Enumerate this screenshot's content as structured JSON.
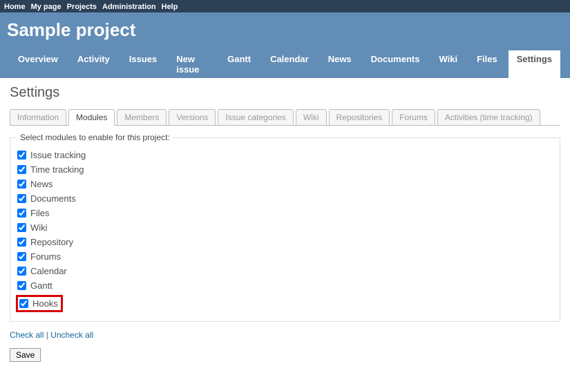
{
  "topMenu": [
    "Home",
    "My page",
    "Projects",
    "Administration",
    "Help"
  ],
  "projectTitle": "Sample project",
  "mainTabs": [
    {
      "label": "Overview",
      "active": false
    },
    {
      "label": "Activity",
      "active": false
    },
    {
      "label": "Issues",
      "active": false
    },
    {
      "label": "New issue",
      "active": false
    },
    {
      "label": "Gantt",
      "active": false
    },
    {
      "label": "Calendar",
      "active": false
    },
    {
      "label": "News",
      "active": false
    },
    {
      "label": "Documents",
      "active": false
    },
    {
      "label": "Wiki",
      "active": false
    },
    {
      "label": "Files",
      "active": false
    },
    {
      "label": "Settings",
      "active": true
    }
  ],
  "pageTitle": "Settings",
  "subTabs": [
    {
      "label": "Information",
      "active": false
    },
    {
      "label": "Modules",
      "active": true
    },
    {
      "label": "Members",
      "active": false
    },
    {
      "label": "Versions",
      "active": false
    },
    {
      "label": "Issue categories",
      "active": false
    },
    {
      "label": "Wiki",
      "active": false
    },
    {
      "label": "Repositories",
      "active": false
    },
    {
      "label": "Forums",
      "active": false
    },
    {
      "label": "Activities (time tracking)",
      "active": false
    }
  ],
  "fieldsetLegend": "Select modules to enable for this project:",
  "modules": [
    {
      "label": "Issue tracking",
      "checked": true,
      "highlighted": false
    },
    {
      "label": "Time tracking",
      "checked": true,
      "highlighted": false
    },
    {
      "label": "News",
      "checked": true,
      "highlighted": false
    },
    {
      "label": "Documents",
      "checked": true,
      "highlighted": false
    },
    {
      "label": "Files",
      "checked": true,
      "highlighted": false
    },
    {
      "label": "Wiki",
      "checked": true,
      "highlighted": false
    },
    {
      "label": "Repository",
      "checked": true,
      "highlighted": false
    },
    {
      "label": "Forums",
      "checked": true,
      "highlighted": false
    },
    {
      "label": "Calendar",
      "checked": true,
      "highlighted": false
    },
    {
      "label": "Gantt",
      "checked": true,
      "highlighted": false
    },
    {
      "label": "Hooks",
      "checked": true,
      "highlighted": true
    }
  ],
  "checkAllLabel": "Check all",
  "uncheckAllLabel": "Uncheck all",
  "saveLabel": "Save"
}
